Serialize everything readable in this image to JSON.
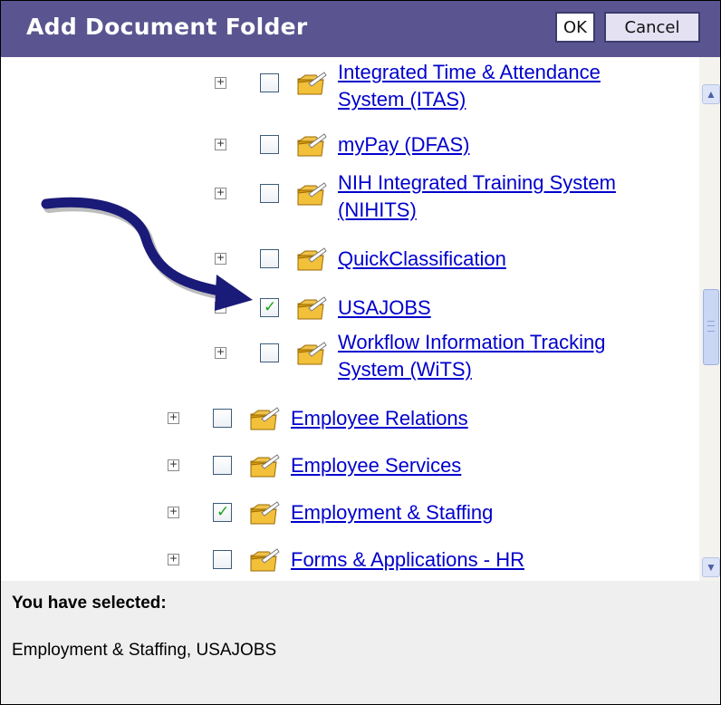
{
  "dialog": {
    "title": "Add Document Folder",
    "ok_label": "OK",
    "cancel_label": "Cancel"
  },
  "tree": [
    {
      "label_lines": [
        "Integrated Time & Attendance",
        "System (ITAS)"
      ],
      "checked": false,
      "level": 2,
      "icon": "folder-icon"
    },
    {
      "label_lines": [
        "myPay (DFAS)"
      ],
      "checked": false,
      "level": 2,
      "icon": "folder-icon"
    },
    {
      "label_lines": [
        "NIH Integrated Training System",
        "(NIHITS)"
      ],
      "checked": false,
      "level": 2,
      "icon": "folder-icon"
    },
    {
      "label_lines": [
        "QuickClassification"
      ],
      "checked": false,
      "level": 2,
      "icon": "folder-icon"
    },
    {
      "label_lines": [
        "USAJOBS"
      ],
      "checked": true,
      "level": 2,
      "icon": "folder-icon"
    },
    {
      "label_lines": [
        "Workflow Information Tracking",
        "System (WiTS)"
      ],
      "checked": false,
      "level": 2,
      "icon": "folder-icon"
    },
    {
      "label_lines": [
        "Employee Relations"
      ],
      "checked": false,
      "level": 1,
      "icon": "folder-icon"
    },
    {
      "label_lines": [
        "Employee Services"
      ],
      "checked": false,
      "level": 1,
      "icon": "folder-icon"
    },
    {
      "label_lines": [
        "Employment & Staffing"
      ],
      "checked": true,
      "level": 1,
      "icon": "folder-icon"
    },
    {
      "label_lines": [
        "Forms & Applications - HR"
      ],
      "checked": false,
      "level": 1,
      "icon": "folder-icon"
    }
  ],
  "selection": {
    "label": "You have selected:",
    "value": "Employment & Staffing, USAJOBS"
  },
  "icons": {
    "expander": "plus-box-icon",
    "checkmark": "✓",
    "scroll_up": "▲",
    "scroll_down": "▼"
  },
  "colors": {
    "titlebar": "#5a5590",
    "link": "#0000cc",
    "check": "#1aa31a",
    "annotation_arrow": "#1a1a78",
    "footer": "#efefef"
  }
}
